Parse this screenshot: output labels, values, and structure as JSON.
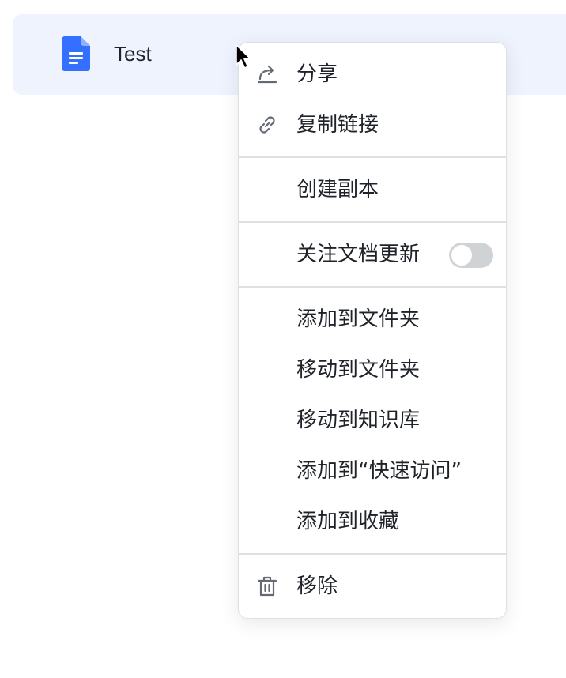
{
  "file": {
    "name": "Test",
    "icon": "google-doc-icon",
    "icon_color": "#3370ff"
  },
  "menu": {
    "share": {
      "label": "分享",
      "icon": "share-icon"
    },
    "copy_link": {
      "label": "复制链接",
      "icon": "link-icon"
    },
    "duplicate": {
      "label": "创建副本"
    },
    "follow_updates": {
      "label": "关注文档更新",
      "toggle_on": false
    },
    "add_to_folder": {
      "label": "添加到文件夹"
    },
    "move_to_folder": {
      "label": "移动到文件夹"
    },
    "move_to_wiki": {
      "label": "移动到知识库"
    },
    "add_to_quick_access": {
      "label": "添加到“快速访问”"
    },
    "add_to_favorites": {
      "label": "添加到收藏"
    },
    "remove": {
      "label": "移除",
      "icon": "trash-icon"
    }
  },
  "colors": {
    "row_highlight": "#eef3fe",
    "menu_border": "#dee0e3",
    "text": "#1f2329",
    "icon": "#646a73",
    "toggle_off": "#d0d3d6"
  }
}
